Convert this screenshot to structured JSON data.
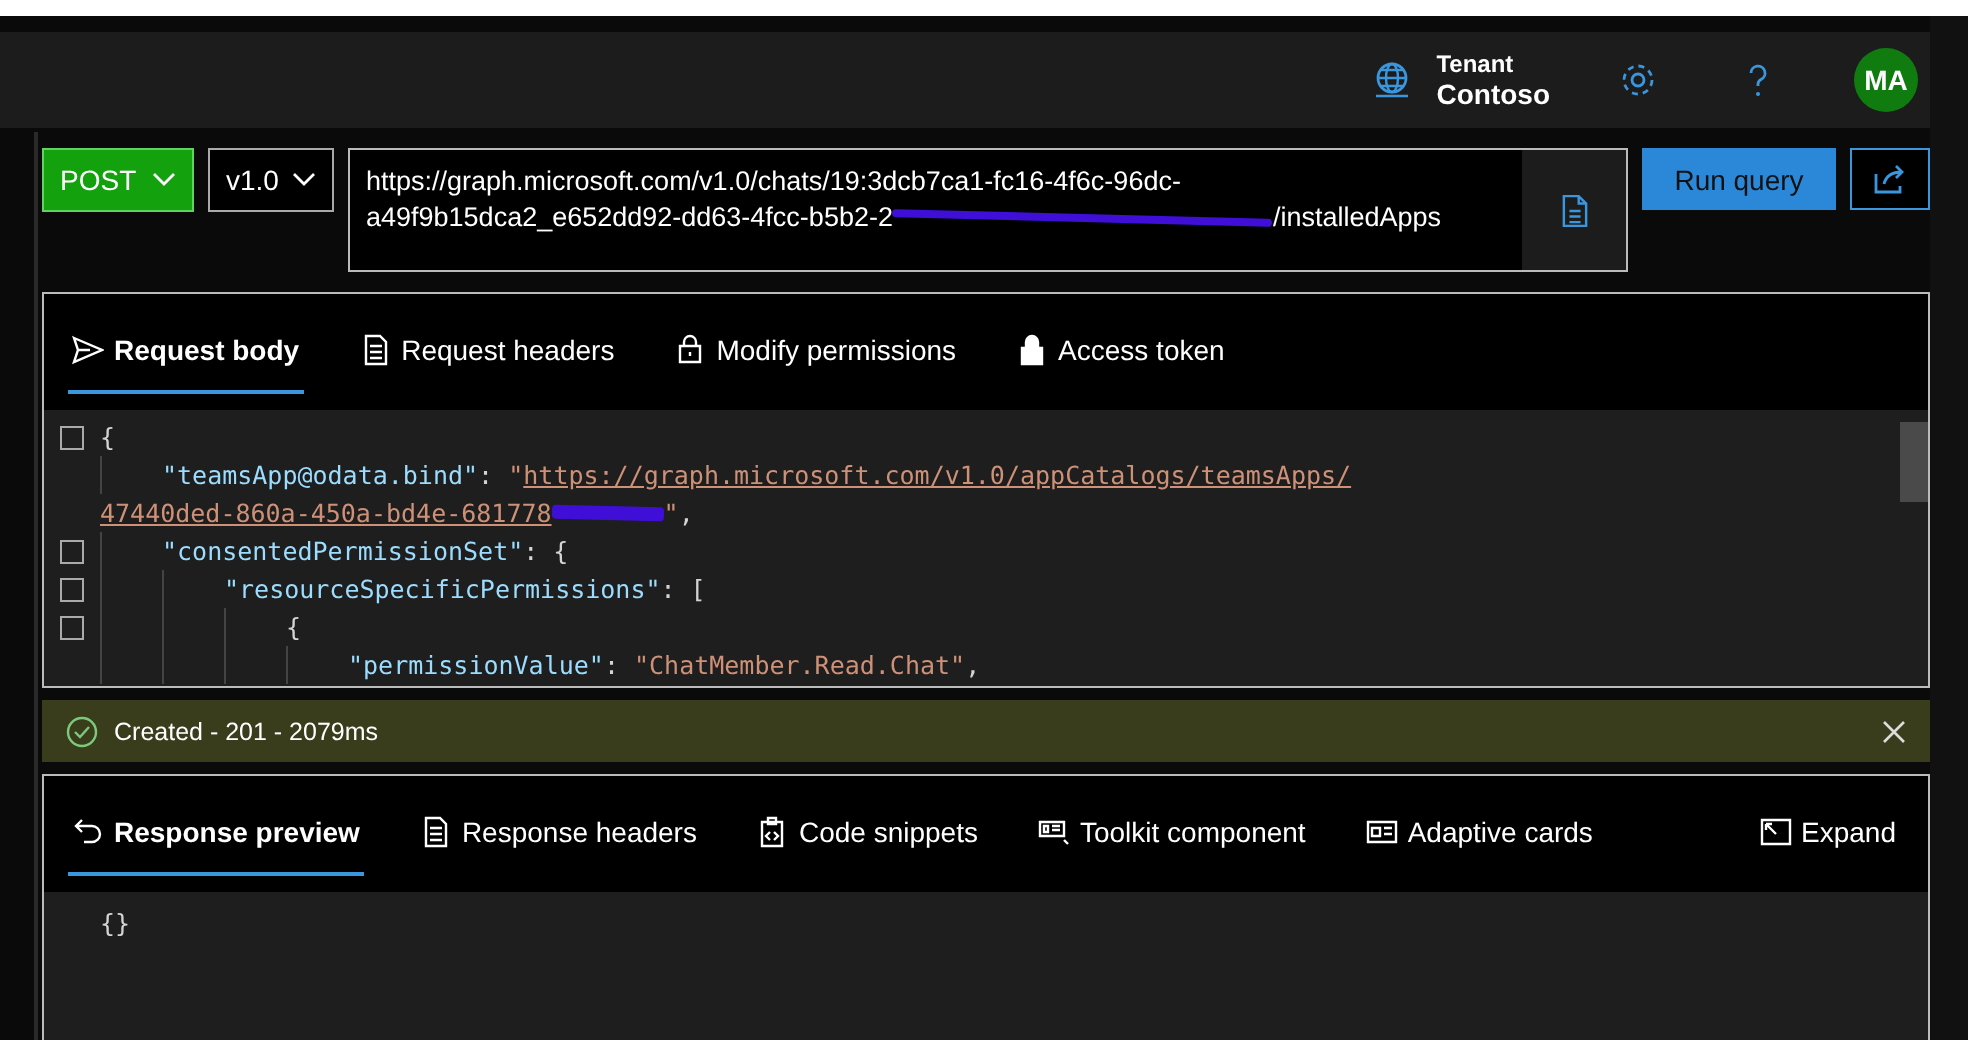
{
  "header": {
    "tenant_label": "Tenant",
    "tenant_name": "Contoso",
    "avatar": "MA"
  },
  "query": {
    "method": "POST",
    "version": "v1.0",
    "url_line_1": "https://graph.microsoft.com/v1.0/chats/19:3dcb7ca1-fc16-4f6c-96dc-",
    "url_line_2_start": "a49f9b15dca2_e652dd92-dd63-4fcc-b5b2-2",
    "url_line_2_end": "/installedApps",
    "run_button": "Run query"
  },
  "request_tabs": [
    {
      "label": "Request body",
      "selected": true
    },
    {
      "label": "Request headers",
      "selected": false
    },
    {
      "label": "Modify permissions",
      "selected": false
    },
    {
      "label": "Access token",
      "selected": false
    }
  ],
  "request_body": [
    {
      "foldable": true,
      "parts": [
        {
          "kind": "punct",
          "text": "{"
        }
      ],
      "children": [
        {
          "foldable": false,
          "parts": [
            {
              "kind": "key",
              "text": "\"teamsApp@odata.bind\""
            },
            {
              "kind": "punct",
              "text": ": "
            },
            {
              "kind": "string",
              "text": "\""
            },
            {
              "kind": "link",
              "text": "https://graph.microsoft.com/v1.0/appCatalogs/teamsApps/"
            }
          ],
          "wrapped_parts": [
            {
              "kind": "link",
              "text": "47440ded-860a-450a-bd4e-681778"
            },
            {
              "kind": "redacted"
            },
            {
              "kind": "string",
              "text": "\""
            },
            {
              "kind": "punct",
              "text": ","
            }
          ]
        },
        {
          "foldable": true,
          "parts": [
            {
              "kind": "key",
              "text": "\"consentedPermissionSet\""
            },
            {
              "kind": "punct",
              "text": ": {"
            }
          ],
          "children": [
            {
              "foldable": true,
              "parts": [
                {
                  "kind": "key",
                  "text": "\"resourceSpecificPermissions\""
                },
                {
                  "kind": "punct",
                  "text": ": ["
                }
              ],
              "children": [
                {
                  "foldable": true,
                  "parts": [
                    {
                      "kind": "punct",
                      "text": "{"
                    }
                  ],
                  "children": [
                    {
                      "foldable": false,
                      "parts": [
                        {
                          "kind": "key",
                          "text": "\"permissionValue\""
                        },
                        {
                          "kind": "punct",
                          "text": ": "
                        },
                        {
                          "kind": "string",
                          "text": "\"ChatMember.Read.Chat\""
                        },
                        {
                          "kind": "punct",
                          "text": ","
                        }
                      ]
                    }
                  ]
                }
              ]
            }
          ]
        }
      ]
    }
  ],
  "status": {
    "text": "Created - 201 - 2079ms",
    "kind": "success"
  },
  "response_tabs": [
    {
      "label": "Response preview",
      "selected": true
    },
    {
      "label": "Response headers",
      "selected": false
    },
    {
      "label": "Code snippets",
      "selected": false
    },
    {
      "label": "Toolkit component",
      "selected": false
    },
    {
      "label": "Adaptive cards",
      "selected": false
    }
  ],
  "expand": "Expand",
  "response_body": "{}"
}
